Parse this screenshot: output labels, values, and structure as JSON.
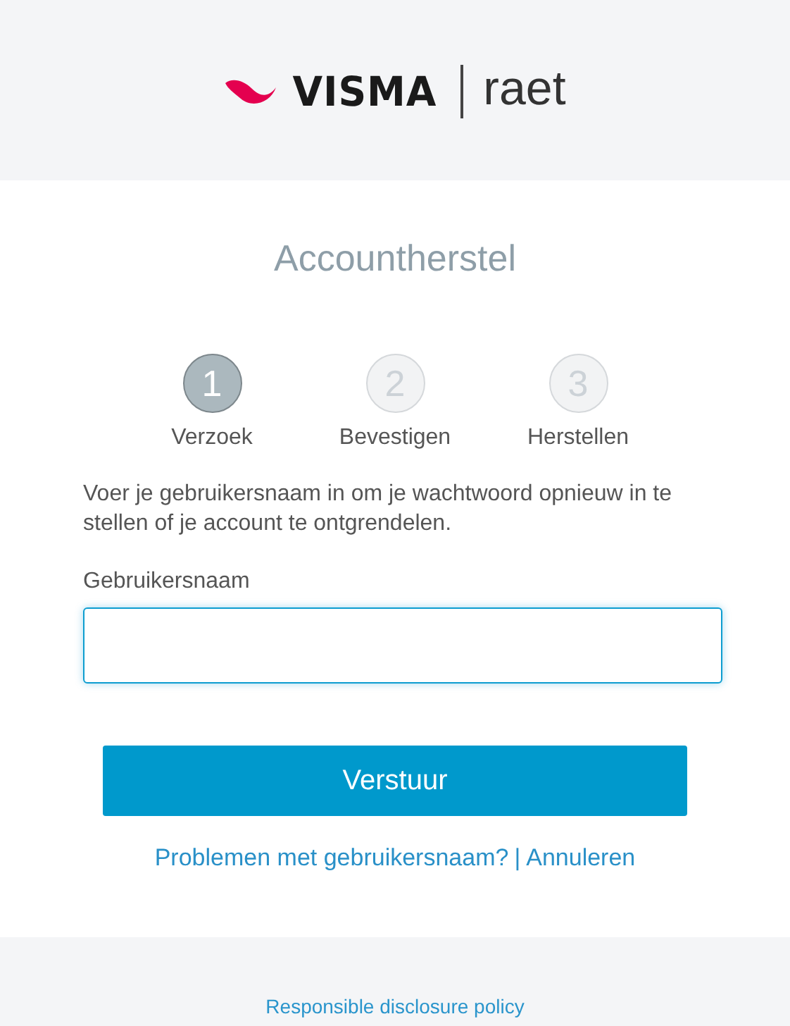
{
  "logo": {
    "brand": "VISMA",
    "product": "raet"
  },
  "title": "Accountherstel",
  "steps": [
    {
      "number": "1",
      "label": "Verzoek",
      "selected": true
    },
    {
      "number": "2",
      "label": "Bevestigen",
      "selected": false
    },
    {
      "number": "3",
      "label": "Herstellen",
      "selected": false
    }
  ],
  "instructions": "Voer je gebruikersnaam in om je wachtwoord opnieuw in te stellen of je account te ontgrendelen.",
  "username_field": {
    "label": "Gebruikersnaam",
    "focused": true
  },
  "submit_button": "Verstuur",
  "links": {
    "help": "Problemen met gebruikersnaam?",
    "separator": "|",
    "cancel": "Annuleren"
  },
  "footer_link": "Responsible disclosure policy"
}
